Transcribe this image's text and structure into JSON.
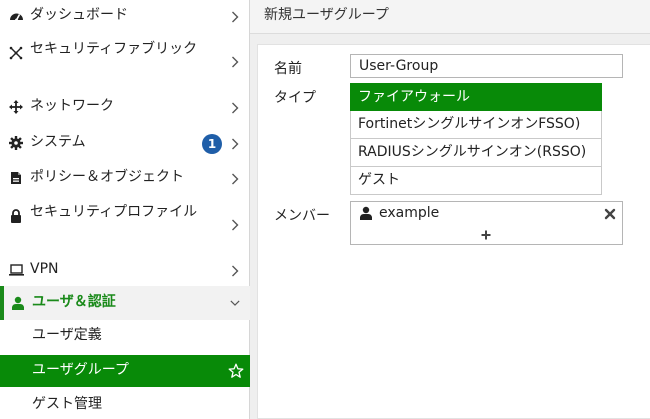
{
  "sidebar": {
    "items": [
      {
        "label": "ダッシュボード",
        "icon": "dashboard-icon"
      },
      {
        "label": "セキュリティファブリック",
        "icon": "fabric-icon"
      },
      {
        "label": "ネットワーク",
        "icon": "network-icon"
      },
      {
        "label": "システム",
        "icon": "gear-icon",
        "badge": "1"
      },
      {
        "label": "ポリシー＆オブジェクト",
        "icon": "policy-icon"
      },
      {
        "label": "セキュリティプロファイル",
        "icon": "lock-icon"
      },
      {
        "label": "VPN",
        "icon": "laptop-icon"
      },
      {
        "label": "ユーザ＆認証",
        "icon": "user-icon"
      }
    ],
    "sub_items": [
      {
        "label": "ユーザ定義"
      },
      {
        "label": "ユーザグループ"
      },
      {
        "label": "ゲスト管理"
      }
    ]
  },
  "main": {
    "title": "新規ユーザグループ",
    "form": {
      "name_label": "名前",
      "name_value": "User-Group",
      "type_label": "タイプ",
      "type_options": [
        "ファイアウォール",
        "FortinetシングルサインオンFSSO)",
        "RADIUSシングルサインオン(RSSO)",
        "ゲスト"
      ],
      "member_label": "メンバー",
      "members": [
        "example"
      ],
      "add_symbol": "+"
    }
  },
  "colors": {
    "accent_green": "#088a08",
    "badge_blue": "#1f5ea8"
  }
}
